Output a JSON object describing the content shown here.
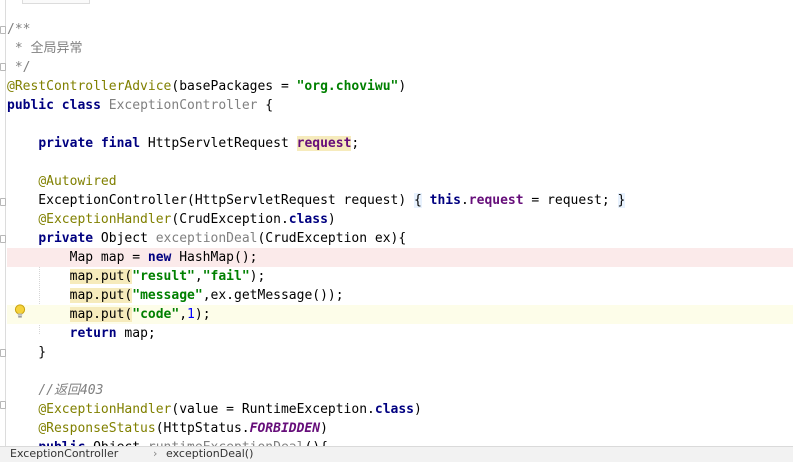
{
  "lines": [
    {
      "id": "l1",
      "segs": [
        {
          "t": "/**",
          "c": "cmt"
        }
      ]
    },
    {
      "id": "l2",
      "segs": [
        {
          "t": " * 全局异常",
          "c": "cmt"
        }
      ]
    },
    {
      "id": "l3",
      "segs": [
        {
          "t": " */",
          "c": "cmt"
        }
      ]
    },
    {
      "id": "l4",
      "segs": [
        {
          "t": "@RestControllerAdvice",
          "c": "ann"
        },
        {
          "t": "(basePackages = "
        },
        {
          "t": "\"org.choviwu\"",
          "c": "str"
        },
        {
          "t": ")"
        }
      ]
    },
    {
      "id": "l5",
      "segs": [
        {
          "t": "public",
          "c": "kw"
        },
        {
          "t": " "
        },
        {
          "t": "class",
          "c": "kw"
        },
        {
          "t": " "
        },
        {
          "t": "ExceptionController",
          "c": "unused"
        },
        {
          "t": " {"
        }
      ]
    },
    {
      "id": "l6",
      "segs": []
    },
    {
      "id": "l7",
      "segs": [
        {
          "t": "    "
        },
        {
          "t": "private",
          "c": "kw"
        },
        {
          "t": " "
        },
        {
          "t": "final",
          "c": "kw"
        },
        {
          "t": " HttpServletRequest "
        },
        {
          "t": "request",
          "c": "fldbg"
        },
        {
          "t": ";"
        }
      ]
    },
    {
      "id": "l8",
      "segs": []
    },
    {
      "id": "l9",
      "segs": [
        {
          "t": "    "
        },
        {
          "t": "@Autowired",
          "c": "ann"
        }
      ]
    },
    {
      "id": "l10",
      "segs": [
        {
          "t": "    ExceptionController(HttpServletRequest request) "
        },
        {
          "t": "{",
          "c": "brace"
        },
        {
          "t": " "
        },
        {
          "t": "this",
          "c": "kw"
        },
        {
          "t": "."
        },
        {
          "t": "request",
          "c": "fld"
        },
        {
          "t": " = request; "
        },
        {
          "t": "}",
          "c": "brace"
        }
      ]
    },
    {
      "id": "l11",
      "segs": [
        {
          "t": "    "
        },
        {
          "t": "@ExceptionHandler",
          "c": "ann"
        },
        {
          "t": "(CrudException."
        },
        {
          "t": "class",
          "c": "kw"
        },
        {
          "t": ")"
        }
      ]
    },
    {
      "id": "l12",
      "segs": [
        {
          "t": "    "
        },
        {
          "t": "private",
          "c": "kw"
        },
        {
          "t": " Object "
        },
        {
          "t": "exceptionDeal",
          "c": "unused"
        },
        {
          "t": "(CrudException ex){"
        }
      ]
    },
    {
      "id": "l13",
      "hl": "red",
      "segs": [
        {
          "t": "        Map map = "
        },
        {
          "t": "new",
          "c": "kw"
        },
        {
          "t": " HashMap();"
        }
      ]
    },
    {
      "id": "l14",
      "segs": [
        {
          "t": "        "
        },
        {
          "t": "map.put(",
          "c": "warnbg"
        },
        {
          "t": "\"result\"",
          "c": "str"
        },
        {
          "t": ","
        },
        {
          "t": "\"fail\"",
          "c": "str"
        },
        {
          "t": ");"
        }
      ]
    },
    {
      "id": "l15",
      "segs": [
        {
          "t": "        "
        },
        {
          "t": "map.put(",
          "c": "warnbg"
        },
        {
          "t": "\"message\"",
          "c": "str"
        },
        {
          "t": ",ex.getMessage());"
        }
      ]
    },
    {
      "id": "l16",
      "hl": "yellow",
      "segs": [
        {
          "t": "        "
        },
        {
          "t": "map.put(",
          "c": "warnbg"
        },
        {
          "t": "\"code\"",
          "c": "str"
        },
        {
          "t": ","
        },
        {
          "t": "1",
          "c": "num"
        },
        {
          "t": ");"
        }
      ]
    },
    {
      "id": "l17",
      "segs": [
        {
          "t": "        "
        },
        {
          "t": "return",
          "c": "kw"
        },
        {
          "t": " map;"
        }
      ]
    },
    {
      "id": "l18",
      "segs": [
        {
          "t": "    }"
        }
      ]
    },
    {
      "id": "l19",
      "segs": []
    },
    {
      "id": "l20",
      "segs": [
        {
          "t": "    "
        },
        {
          "t": "//返回403",
          "c": "cmti"
        }
      ]
    },
    {
      "id": "l21",
      "segs": [
        {
          "t": "    "
        },
        {
          "t": "@ExceptionHandler",
          "c": "ann"
        },
        {
          "t": "(value = RuntimeException."
        },
        {
          "t": "class",
          "c": "kw"
        },
        {
          "t": ")"
        }
      ]
    },
    {
      "id": "l22",
      "segs": [
        {
          "t": "    "
        },
        {
          "t": "@ResponseStatus",
          "c": "ann"
        },
        {
          "t": "(HttpStatus."
        },
        {
          "t": "FORBIDDEN",
          "c": "cst"
        },
        {
          "t": ")"
        }
      ]
    },
    {
      "id": "l23",
      "segs": [
        {
          "t": "    "
        },
        {
          "t": "public",
          "c": "kw"
        },
        {
          "t": " Object "
        },
        {
          "t": "runtimeExceptionDeal",
          "c": "unused"
        },
        {
          "t": "(){"
        }
      ]
    }
  ],
  "breadcrumb": {
    "class_name": "ExceptionController",
    "separator": "›",
    "method_name": "exceptionDeal()"
  },
  "gutter": {
    "intention_icon": "lightbulb-icon"
  },
  "colors": {
    "keyword": "#000080",
    "string": "#008000",
    "annotation": "#808000",
    "comment": "#808080",
    "field": "#660e7a",
    "number": "#0000ff"
  }
}
